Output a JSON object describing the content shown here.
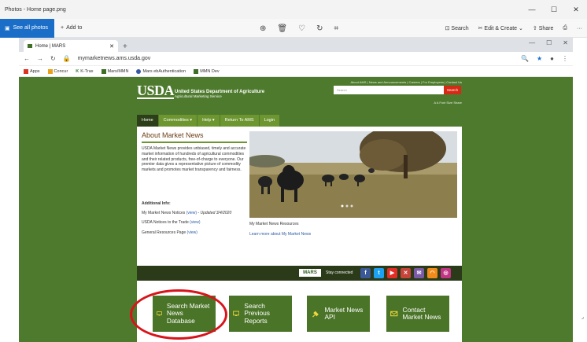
{
  "photos_app": {
    "title": "Photos - Home page.png",
    "see_all_label": "See all photos",
    "add_to_label": "Add to",
    "search_label": "Search",
    "edit_label": "Edit & Create",
    "share_label": "Share"
  },
  "browser": {
    "tab_title": "Home | MARS",
    "url": "mymarketnews.ams.usda.gov",
    "bookmarks": [
      "Apps",
      "Concur",
      "K-Trax",
      "Mars/MMN",
      "Mars ebAuthentication",
      "MMN Dev"
    ]
  },
  "site": {
    "logo": "USDA",
    "agency_name": "United States Department of Agriculture",
    "agency_sub": "Agricultural Marketing Service",
    "top_links": "About AMS | News and Announcements | Careers | For Employees | Contact Us",
    "search_placeholder": "Search",
    "search_button": "Search",
    "font_size_label": "A A Font Size  Share",
    "nav": [
      "Home",
      "Commodities ▾",
      "Help ▾",
      "Return To AMS",
      "Login"
    ],
    "about_heading": "About Market News",
    "about_text": "USDA Market News provides unbiased, timely and accurate market information of hundreds of agricultural commodities and their related products, free-of-charge to everyone. Our premier data gives a representative picture of commodity markets and promotes market transparency and fairness.",
    "additional_heading": "Additional Info:",
    "additional": [
      {
        "text": "My Market News Notices",
        "link": "(view)",
        "extra": " - Updated 3/4/2020"
      },
      {
        "text": "USDA Notices to the Trade",
        "link": "(view)",
        "extra": ""
      },
      {
        "text": "General Resources Page",
        "link": "(view)",
        "extra": ""
      }
    ],
    "photo_caption": "My Market News Resources",
    "learn_more": "Learn more about My Market News",
    "mars_logo": "MARS",
    "stay_connected": "Stay connected",
    "buttons": [
      "Search Market News Database",
      "Search Previous Reports",
      "Market News API",
      "Contact Market News"
    ]
  },
  "colors": {
    "page_green": "#4e7a2e",
    "nav_green": "#6d9630",
    "button_green": "#4a7428",
    "highlight_red": "#d8141a",
    "search_red": "#d62a17"
  }
}
